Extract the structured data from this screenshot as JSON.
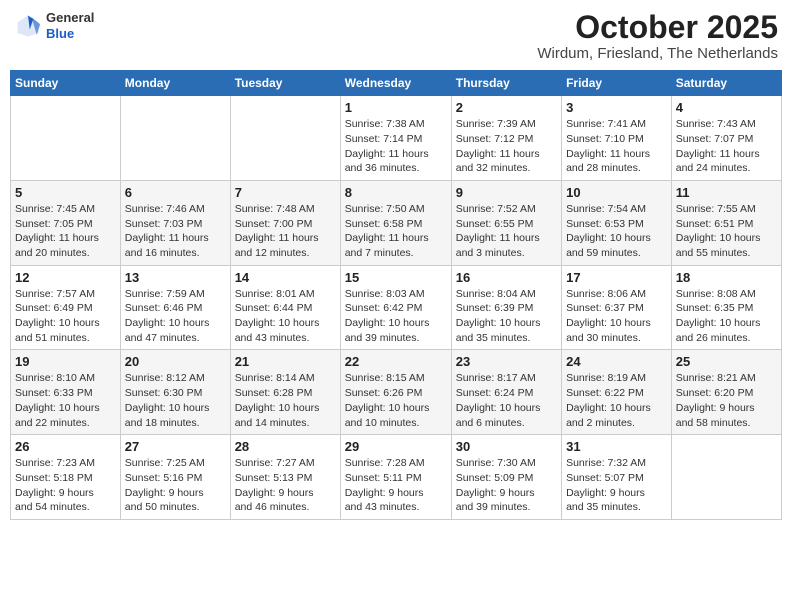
{
  "header": {
    "logo_general": "General",
    "logo_blue": "Blue",
    "main_title": "October 2025",
    "subtitle": "Wirdum, Friesland, The Netherlands"
  },
  "weekdays": [
    "Sunday",
    "Monday",
    "Tuesday",
    "Wednesday",
    "Thursday",
    "Friday",
    "Saturday"
  ],
  "weeks": [
    [
      {
        "day": "",
        "info": ""
      },
      {
        "day": "",
        "info": ""
      },
      {
        "day": "",
        "info": ""
      },
      {
        "day": "1",
        "info": "Sunrise: 7:38 AM\nSunset: 7:14 PM\nDaylight: 11 hours\nand 36 minutes."
      },
      {
        "day": "2",
        "info": "Sunrise: 7:39 AM\nSunset: 7:12 PM\nDaylight: 11 hours\nand 32 minutes."
      },
      {
        "day": "3",
        "info": "Sunrise: 7:41 AM\nSunset: 7:10 PM\nDaylight: 11 hours\nand 28 minutes."
      },
      {
        "day": "4",
        "info": "Sunrise: 7:43 AM\nSunset: 7:07 PM\nDaylight: 11 hours\nand 24 minutes."
      }
    ],
    [
      {
        "day": "5",
        "info": "Sunrise: 7:45 AM\nSunset: 7:05 PM\nDaylight: 11 hours\nand 20 minutes."
      },
      {
        "day": "6",
        "info": "Sunrise: 7:46 AM\nSunset: 7:03 PM\nDaylight: 11 hours\nand 16 minutes."
      },
      {
        "day": "7",
        "info": "Sunrise: 7:48 AM\nSunset: 7:00 PM\nDaylight: 11 hours\nand 12 minutes."
      },
      {
        "day": "8",
        "info": "Sunrise: 7:50 AM\nSunset: 6:58 PM\nDaylight: 11 hours\nand 7 minutes."
      },
      {
        "day": "9",
        "info": "Sunrise: 7:52 AM\nSunset: 6:55 PM\nDaylight: 11 hours\nand 3 minutes."
      },
      {
        "day": "10",
        "info": "Sunrise: 7:54 AM\nSunset: 6:53 PM\nDaylight: 10 hours\nand 59 minutes."
      },
      {
        "day": "11",
        "info": "Sunrise: 7:55 AM\nSunset: 6:51 PM\nDaylight: 10 hours\nand 55 minutes."
      }
    ],
    [
      {
        "day": "12",
        "info": "Sunrise: 7:57 AM\nSunset: 6:49 PM\nDaylight: 10 hours\nand 51 minutes."
      },
      {
        "day": "13",
        "info": "Sunrise: 7:59 AM\nSunset: 6:46 PM\nDaylight: 10 hours\nand 47 minutes."
      },
      {
        "day": "14",
        "info": "Sunrise: 8:01 AM\nSunset: 6:44 PM\nDaylight: 10 hours\nand 43 minutes."
      },
      {
        "day": "15",
        "info": "Sunrise: 8:03 AM\nSunset: 6:42 PM\nDaylight: 10 hours\nand 39 minutes."
      },
      {
        "day": "16",
        "info": "Sunrise: 8:04 AM\nSunset: 6:39 PM\nDaylight: 10 hours\nand 35 minutes."
      },
      {
        "day": "17",
        "info": "Sunrise: 8:06 AM\nSunset: 6:37 PM\nDaylight: 10 hours\nand 30 minutes."
      },
      {
        "day": "18",
        "info": "Sunrise: 8:08 AM\nSunset: 6:35 PM\nDaylight: 10 hours\nand 26 minutes."
      }
    ],
    [
      {
        "day": "19",
        "info": "Sunrise: 8:10 AM\nSunset: 6:33 PM\nDaylight: 10 hours\nand 22 minutes."
      },
      {
        "day": "20",
        "info": "Sunrise: 8:12 AM\nSunset: 6:30 PM\nDaylight: 10 hours\nand 18 minutes."
      },
      {
        "day": "21",
        "info": "Sunrise: 8:14 AM\nSunset: 6:28 PM\nDaylight: 10 hours\nand 14 minutes."
      },
      {
        "day": "22",
        "info": "Sunrise: 8:15 AM\nSunset: 6:26 PM\nDaylight: 10 hours\nand 10 minutes."
      },
      {
        "day": "23",
        "info": "Sunrise: 8:17 AM\nSunset: 6:24 PM\nDaylight: 10 hours\nand 6 minutes."
      },
      {
        "day": "24",
        "info": "Sunrise: 8:19 AM\nSunset: 6:22 PM\nDaylight: 10 hours\nand 2 minutes."
      },
      {
        "day": "25",
        "info": "Sunrise: 8:21 AM\nSunset: 6:20 PM\nDaylight: 9 hours\nand 58 minutes."
      }
    ],
    [
      {
        "day": "26",
        "info": "Sunrise: 7:23 AM\nSunset: 5:18 PM\nDaylight: 9 hours\nand 54 minutes."
      },
      {
        "day": "27",
        "info": "Sunrise: 7:25 AM\nSunset: 5:16 PM\nDaylight: 9 hours\nand 50 minutes."
      },
      {
        "day": "28",
        "info": "Sunrise: 7:27 AM\nSunset: 5:13 PM\nDaylight: 9 hours\nand 46 minutes."
      },
      {
        "day": "29",
        "info": "Sunrise: 7:28 AM\nSunset: 5:11 PM\nDaylight: 9 hours\nand 43 minutes."
      },
      {
        "day": "30",
        "info": "Sunrise: 7:30 AM\nSunset: 5:09 PM\nDaylight: 9 hours\nand 39 minutes."
      },
      {
        "day": "31",
        "info": "Sunrise: 7:32 AM\nSunset: 5:07 PM\nDaylight: 9 hours\nand 35 minutes."
      },
      {
        "day": "",
        "info": ""
      }
    ]
  ]
}
